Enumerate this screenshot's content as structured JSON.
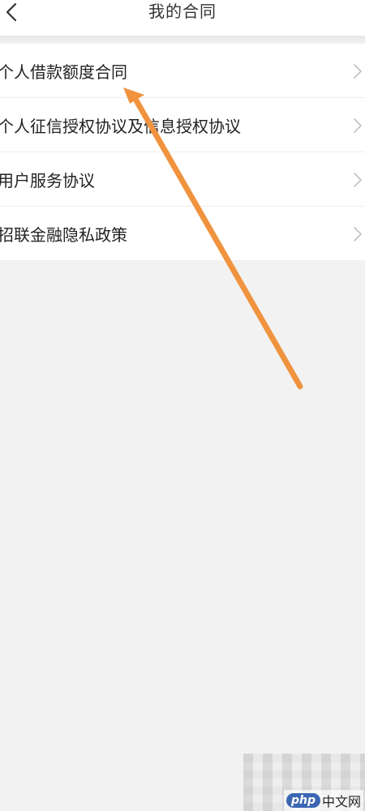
{
  "header": {
    "title": "我的合同",
    "back_icon": "chevron-left-icon"
  },
  "contracts": {
    "items": [
      {
        "label": "个人借款额度合同",
        "icon": "chevron-right-icon"
      },
      {
        "label": "个人征信授权协议及信息授权协议",
        "icon": "chevron-right-icon"
      },
      {
        "label": "用户服务协议",
        "icon": "chevron-right-icon"
      },
      {
        "label": "招联金融隐私政策",
        "icon": "chevron-right-icon"
      }
    ]
  },
  "annotation": {
    "color": "#f0933f",
    "points_to": "contracts.items.0"
  },
  "watermark": {
    "logo_text": "php",
    "site_text": "中文网"
  },
  "colors": {
    "background": "#f2f2f2",
    "surface": "#ffffff",
    "text": "#222222",
    "chevron": "#c4c4c4"
  }
}
